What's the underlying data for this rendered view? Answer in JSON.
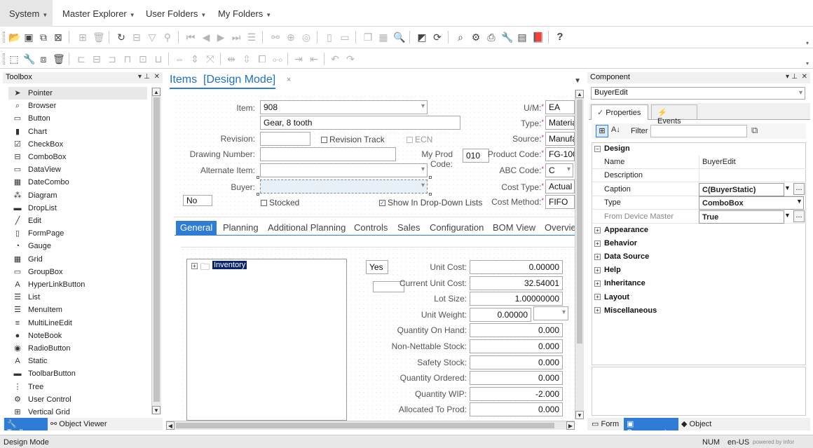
{
  "menu": {
    "system": "System",
    "master_explorer": "Master Explorer",
    "user_folders": "User Folders",
    "my_folders": "My Folders"
  },
  "toolbox": {
    "title": "Toolbox",
    "items": [
      "Pointer",
      "Browser",
      "Button",
      "Chart",
      "CheckBox",
      "ComboBox",
      "DataView",
      "DateCombo",
      "Diagram",
      "DropList",
      "Edit",
      "FormPage",
      "Gauge",
      "Grid",
      "GroupBox",
      "HyperLinkButton",
      "List",
      "MenuItem",
      "MultiLineEdit",
      "NoteBook",
      "RadioButton",
      "Static",
      "ToolbarButton",
      "Tree",
      "User Control",
      "Vertical Grid"
    ],
    "tab_toolbox": "Toolbox",
    "tab_object_viewer": "Object Viewer"
  },
  "doc": {
    "title": "Items  [Design Mode]",
    "close": "×"
  },
  "form": {
    "item_label": "Item:",
    "item_value": "908",
    "desc_value": "Gear, 8 tooth",
    "revision_label": "Revision:",
    "revision_track": "Revision Track",
    "ecn": "ECN",
    "drawing_label": "Drawing Number:",
    "myprod_label": "My Prod Code:",
    "myprod_value": "010",
    "alternate_label": "Alternate Item:",
    "buyer_label": "Buyer:",
    "no_value": "No",
    "stocked": "Stocked",
    "show_dd": "Show In Drop-Down Lists",
    "um_label": "U/M:",
    "um_value": "EA",
    "type_label": "Type:",
    "type_value": "Materia",
    "source_label": "Source:",
    "source_value": "Manufa",
    "product_label": "Product Code:",
    "product_value": "FG-100",
    "abc_label": "ABC Code:",
    "abc_value": "C",
    "costtype_label": "Cost Type:",
    "costtype_value": "Actual",
    "costmethod_label": "Cost Method:",
    "costmethod_value": "FIFO"
  },
  "tabs": [
    "General",
    "Planning",
    "Additional Planning",
    "Controls",
    "Sales",
    "Configuration",
    "BOM View",
    "Overvie"
  ],
  "general": {
    "tree_node": "Inventory",
    "yes_value": "Yes",
    "rows": [
      {
        "label": "Unit Cost:",
        "value": "0.00000"
      },
      {
        "label": "Current Unit Cost:",
        "value": "32.54001"
      },
      {
        "label": "Lot Size:",
        "value": "1.00000000"
      },
      {
        "label": "Unit Weight:",
        "value": "0.00000"
      },
      {
        "label": "Quantity On Hand:",
        "value": "0.000"
      },
      {
        "label": "Non-Nettable Stock:",
        "value": "0.000"
      },
      {
        "label": "Safety Stock:",
        "value": "0.000"
      },
      {
        "label": "Quantity Ordered:",
        "value": "0.000"
      },
      {
        "label": "Quantity WIP:",
        "value": "-2.000"
      },
      {
        "label": "Allocated To Prod:",
        "value": "0.000"
      }
    ]
  },
  "component": {
    "title": "Component",
    "selected": "BuyerEdit",
    "tab_properties": "Properties",
    "tab_events": "Events",
    "filter_label": "Filter",
    "design_section": "Design",
    "props": [
      {
        "k": "Name",
        "v": "BuyerEdit"
      },
      {
        "k": "Description",
        "v": ""
      },
      {
        "k": "Caption",
        "v": "C(BuyerStatic)"
      },
      {
        "k": "Type",
        "v": "ComboBox"
      },
      {
        "k": "From Device Master",
        "v": "True"
      }
    ],
    "sections": [
      "Appearance",
      "Behavior",
      "Data Source",
      "Help",
      "Inheritance",
      "Layout",
      "Miscellaneous"
    ],
    "bottom_tabs": [
      "Form",
      "Component",
      "Object"
    ]
  },
  "status": {
    "mode": "Design Mode",
    "num": "NUM",
    "locale": "en-US",
    "brand": "powered by infor"
  },
  "colors": {
    "accent": "#2f7cd6",
    "title_blue": "#1f6fbf"
  }
}
